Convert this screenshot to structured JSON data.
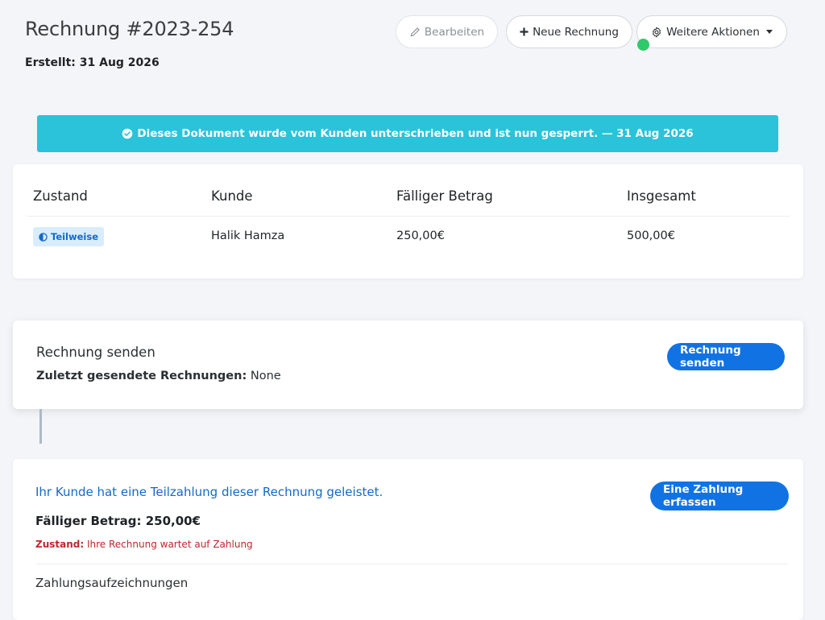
{
  "header": {
    "title": "Rechnung #2023-254",
    "created": "Erstellt: 31 Aug 2026"
  },
  "toolbar": {
    "edit_label": "Bearbeiten",
    "new_invoice_label": "Neue Rechnung",
    "more_actions_label": "Weitere Aktionen"
  },
  "alert": {
    "text": "Dieses Dokument wurde vom Kunden unterschrieben und ist nun gesperrt. — 31 Aug 2026",
    "color": "#2ac3d9"
  },
  "summary": {
    "columns": [
      "Zustand",
      "Kunde",
      "Fälliger Betrag",
      "Insgesamt"
    ],
    "row": {
      "status": "Teilweise",
      "customer": "Halik Hamza",
      "amount_due": "250,00€",
      "total": "500,00€"
    }
  },
  "send": {
    "title": "Rechnung senden",
    "last_sent_label": "Zuletzt gesendete Rechnungen:",
    "last_sent_value": "None",
    "button_label": "Rechnung senden"
  },
  "payment": {
    "title": "Ihr Kunde hat eine Teilzahlung dieser Rechnung geleistet.",
    "due": "Fälliger Betrag: 250,00€",
    "state_label": "Zustand:",
    "state_value": "Ihre Rechnung wartet auf Zahlung",
    "button_label": "Eine Zahlung erfassen",
    "records_title": "Zahlungsaufzeichnungen"
  },
  "colors": {
    "primary": "#1173e3",
    "status_badge_bg": "#d9ecfb",
    "indicator_green": "#2ec96a",
    "danger": "#c0262d"
  }
}
